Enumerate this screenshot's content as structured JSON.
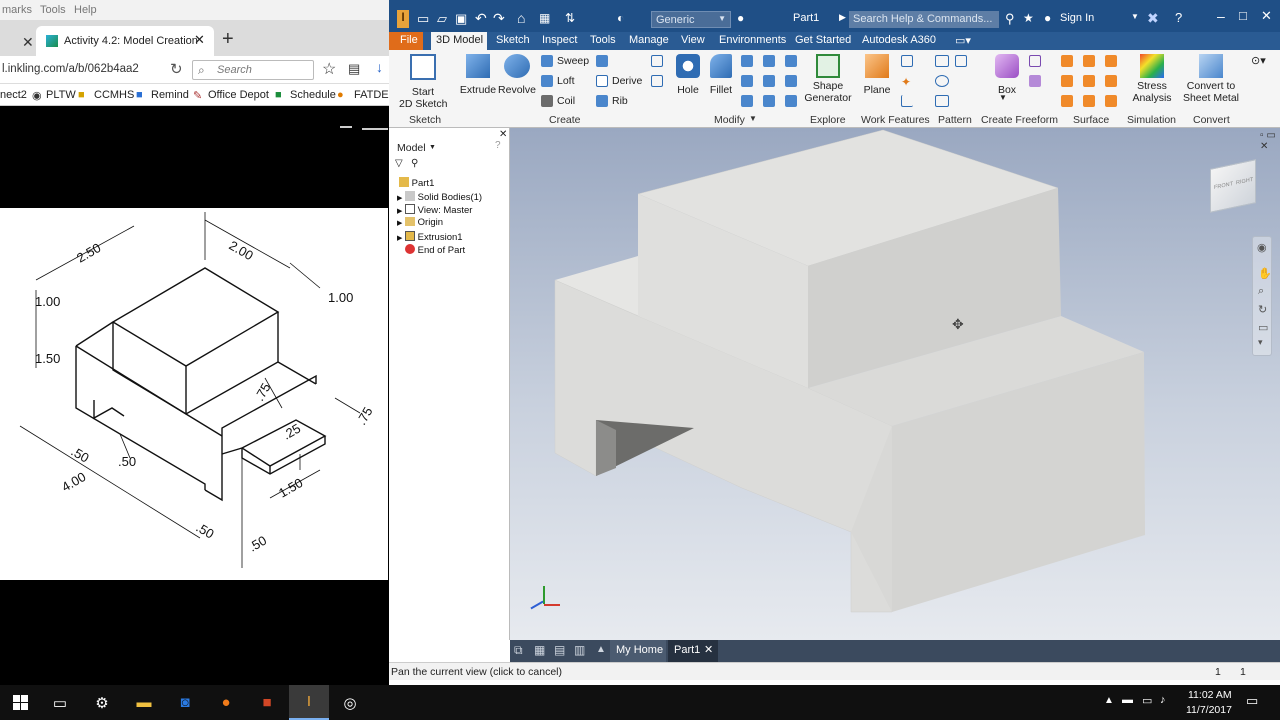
{
  "chrome": {
    "menu": [
      "marks",
      "Tools",
      "Help"
    ],
    "tab_title": "Activity 4.2: Model Creation",
    "url": "l.inkling.com/a/b/062b4aa2",
    "search_placeholder": "Search",
    "bookmarks": [
      "nect2",
      "PLTW",
      "CCMHS",
      "Remind",
      "Office Depot",
      "Schedule",
      "FATDEC"
    ]
  },
  "drawing": {
    "dims": [
      "2.50",
      "2.00",
      "1.00",
      "1.00",
      "1.50",
      ".75",
      ".75",
      ".25",
      ".50",
      ".50",
      "4.00",
      ".50",
      "1.50",
      ".50"
    ]
  },
  "inventor": {
    "material": "Generic",
    "doc_name": "Part1",
    "help_placeholder": "Search Help & Commands...",
    "sign_in": "Sign In",
    "tabs": [
      "File",
      "3D Model",
      "Sketch",
      "Inspect",
      "Tools",
      "Manage",
      "View",
      "Environments",
      "Get Started",
      "Autodesk A360"
    ],
    "ribbon": {
      "start_sketch": [
        "Start",
        "2D Sketch"
      ],
      "extrude": "Extrude",
      "revolve": "Revolve",
      "sweep": "Sweep",
      "loft": "Loft",
      "coil": "Coil",
      "derive": "Derive",
      "rib": "Rib",
      "hole": "Hole",
      "fillet": "Fillet",
      "shape_generator": [
        "Shape",
        "Generator"
      ],
      "plane": "Plane",
      "box": "Box",
      "stress": [
        "Stress",
        "Analysis"
      ],
      "convert": [
        "Convert to",
        "Sheet Metal"
      ],
      "groups": [
        "Sketch",
        "Create",
        "Modify",
        "Explore",
        "Work Features",
        "Pattern",
        "Create Freeform",
        "Surface",
        "Simulation",
        "Convert"
      ]
    },
    "browser": {
      "title": "Model",
      "items": [
        "Part1",
        "Solid Bodies(1)",
        "View: Master",
        "Origin",
        "Extrusion1",
        "End of Part"
      ]
    },
    "viewcube": [
      "FRONT",
      "RIGHT"
    ],
    "doc_tabs": [
      "My Home",
      "Part1"
    ],
    "status_text": "Pan the current view (click to cancel)",
    "status_nums": [
      "1",
      "1"
    ]
  },
  "taskbar": {
    "time": "11:02 AM",
    "date": "11/7/2017"
  }
}
